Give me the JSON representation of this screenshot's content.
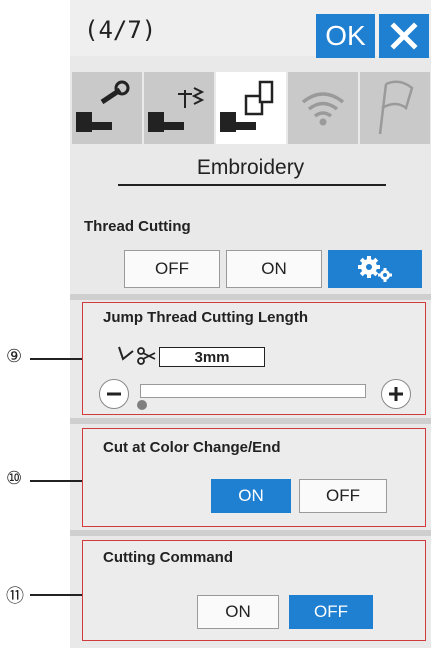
{
  "header": {
    "page_indicator": "(4/7)",
    "ok_label": "OK"
  },
  "tabs": [
    {
      "icon": "wrench-icon"
    },
    {
      "icon": "stitch-icon"
    },
    {
      "icon": "embroidery-hoop-icon",
      "active": true
    },
    {
      "icon": "wifi-icon"
    },
    {
      "icon": "flag-icon"
    }
  ],
  "section_title": "Embroidery",
  "thread_cutting": {
    "label": "Thread Cutting",
    "off_label": "OFF",
    "on_label": "ON"
  },
  "jump_thread": {
    "title": "Jump Thread Cutting Length",
    "value": "3mm",
    "slider_level": 0,
    "callout": "⑨"
  },
  "color_change": {
    "title": "Cut at Color Change/End",
    "on_label": "ON",
    "off_label": "OFF",
    "selected": "ON",
    "callout": "⑩"
  },
  "cutting_command": {
    "title": "Cutting Command",
    "on_label": "ON",
    "off_label": "OFF",
    "selected": "OFF",
    "callout": "⑪"
  },
  "colors": {
    "accent": "#1f7fd1",
    "frame": "#d23b3b"
  }
}
